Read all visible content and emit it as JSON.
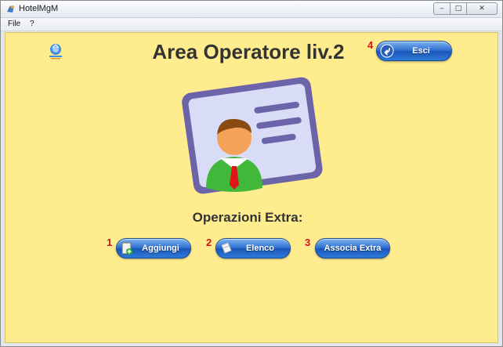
{
  "window": {
    "title": "HotelMgM"
  },
  "menubar": {
    "items": [
      "File",
      "?"
    ]
  },
  "main": {
    "heading": "Area Operatore liv.2",
    "subheading": "Operazioni Extra:"
  },
  "buttons": {
    "exit": {
      "label": "Esci",
      "badge": "4"
    },
    "add": {
      "label": "Aggiungi",
      "badge": "1"
    },
    "list": {
      "label": "Elenco",
      "badge": "2"
    },
    "associate": {
      "label": "Associa Extra",
      "badge": "3"
    }
  },
  "colors": {
    "background": "#feec8e",
    "button": "#2d6fd0",
    "badge": "#d0141a",
    "heading": "#333333"
  },
  "icons": {
    "logo": "hotel-logo-icon",
    "card": "user-card-icon",
    "exit": "back-arrow-icon",
    "add": "add-document-icon",
    "list": "document-icon"
  }
}
